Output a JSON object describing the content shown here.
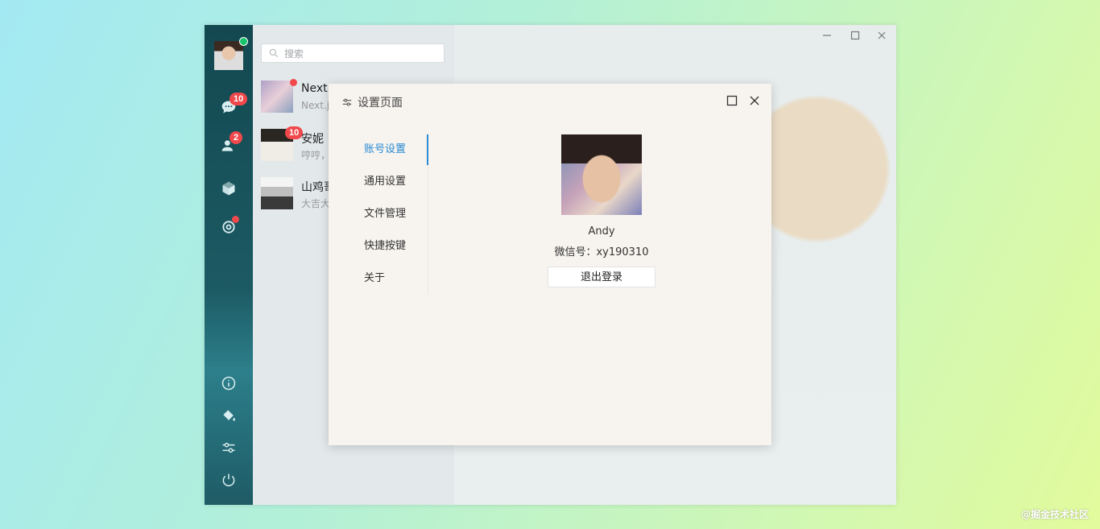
{
  "search": {
    "placeholder": "搜索"
  },
  "badges": {
    "chat": "10",
    "contacts": "2"
  },
  "chats": [
    {
      "name": "Next.",
      "preview": "Next.j"
    },
    {
      "name": "安妮",
      "preview": "哼哼，",
      "badge": "10"
    },
    {
      "name": "山鸡哥",
      "preview": "大吉大"
    }
  ],
  "dialog": {
    "title": "设置页面",
    "menu": [
      "账号设置",
      "通用设置",
      "文件管理",
      "快捷按键",
      "关于"
    ],
    "profile": {
      "name": "Andy",
      "wechat_id": "微信号：xy190310"
    },
    "logout_label": "退出登录"
  },
  "watermark": "@掘金技术社区",
  "colors": {
    "accent": "#2a8ad4",
    "badge": "#f0484b",
    "online": "#19c36b",
    "sidebar": "#1a5660"
  }
}
